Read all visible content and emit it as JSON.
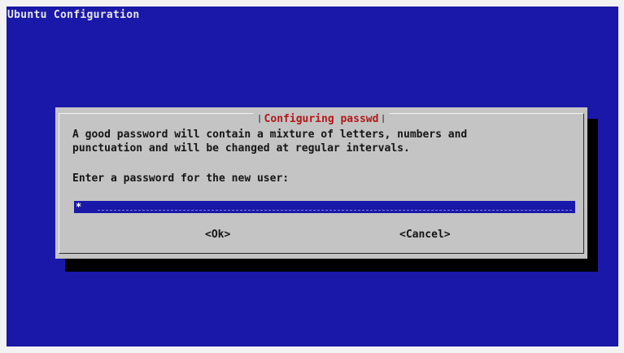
{
  "screen": {
    "backtitle": "Ubuntu Configuration"
  },
  "dialog": {
    "title": "Configuring passwd",
    "message": "A good password will contain a mixture of letters, numbers and\npunctuation and will be changed at regular intervals.",
    "prompt": "Enter a password for the new user:",
    "password_value": "*",
    "ok_label": "<Ok>",
    "cancel_label": "<Cancel>"
  },
  "colors": {
    "background_blue": "#1a18a8",
    "dialog_gray": "#c4c4c4",
    "title_red": "#b01818",
    "shadow": "#000000"
  }
}
